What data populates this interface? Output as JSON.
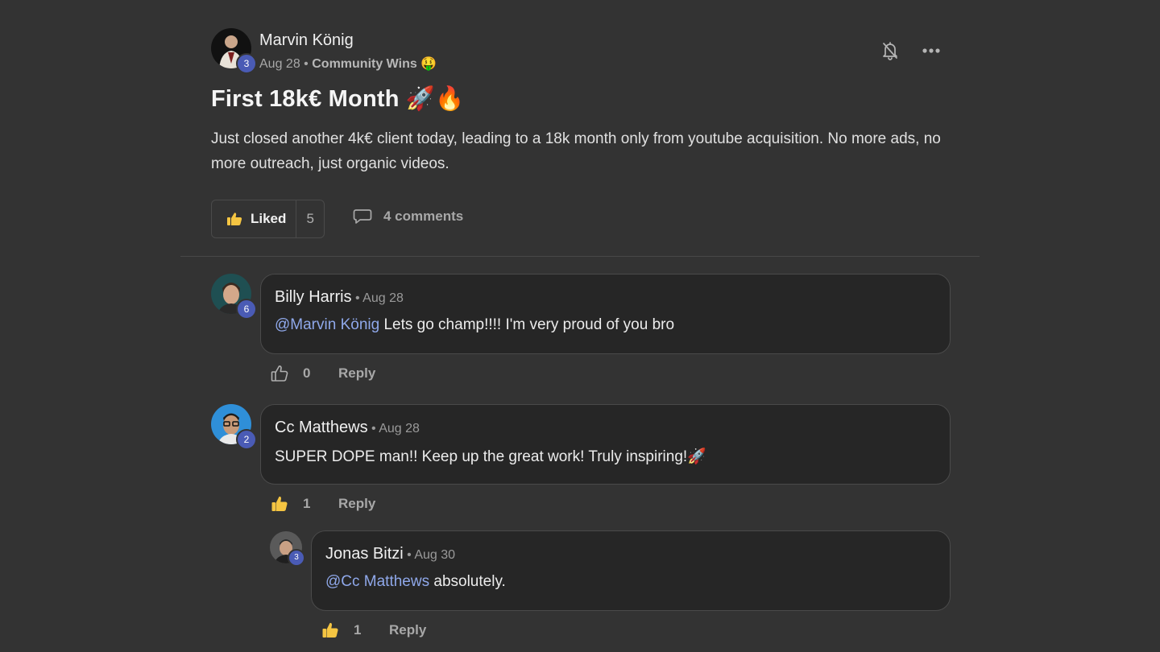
{
  "post": {
    "author": {
      "name": "Marvin König",
      "level": "3",
      "date": "Aug 28",
      "separator": "•",
      "category": "Community Wins",
      "category_emoji": "🤑"
    },
    "title": "First 18k€ Month 🚀🔥",
    "body": "Just closed another 4k€ client today, leading to a 18k month only from youtube acquisition. No more ads, no more outreach, just organic videos.",
    "like_label": "Liked",
    "like_count": "5",
    "comments_label": "4 comments",
    "icons": {
      "notify": "bell-off-icon",
      "more": "more-horizontal-icon",
      "like": "thumbs-up-icon",
      "comments": "comment-bubble-icon"
    }
  },
  "comments": [
    {
      "name": "Billy Harris",
      "level": "6",
      "date": "• Aug 28",
      "mention": "@Marvin König",
      "text": " Lets go champ!!!! I'm very proud of you bro",
      "like_count": "0",
      "liked": false,
      "reply_label": "Reply"
    },
    {
      "name": "Cc Matthews",
      "level": "2",
      "date": "• Aug 28",
      "mention": "",
      "text": "SUPER DOPE man!! Keep up the great work! Truly inspiring!🚀",
      "like_count": "1",
      "liked": true,
      "reply_label": "Reply"
    },
    {
      "name": "Jonas Bitzi",
      "level": "3",
      "date": "• Aug 30",
      "mention": "@Cc Matthews",
      "text": " absolutely.",
      "like_count": "1",
      "liked": true,
      "reply_label": "Reply"
    }
  ],
  "colors": {
    "background": "#333333",
    "card": "#262626",
    "mention": "#8fa8ea",
    "like_active": "#f5c542",
    "badge": "#4a5bb5"
  }
}
